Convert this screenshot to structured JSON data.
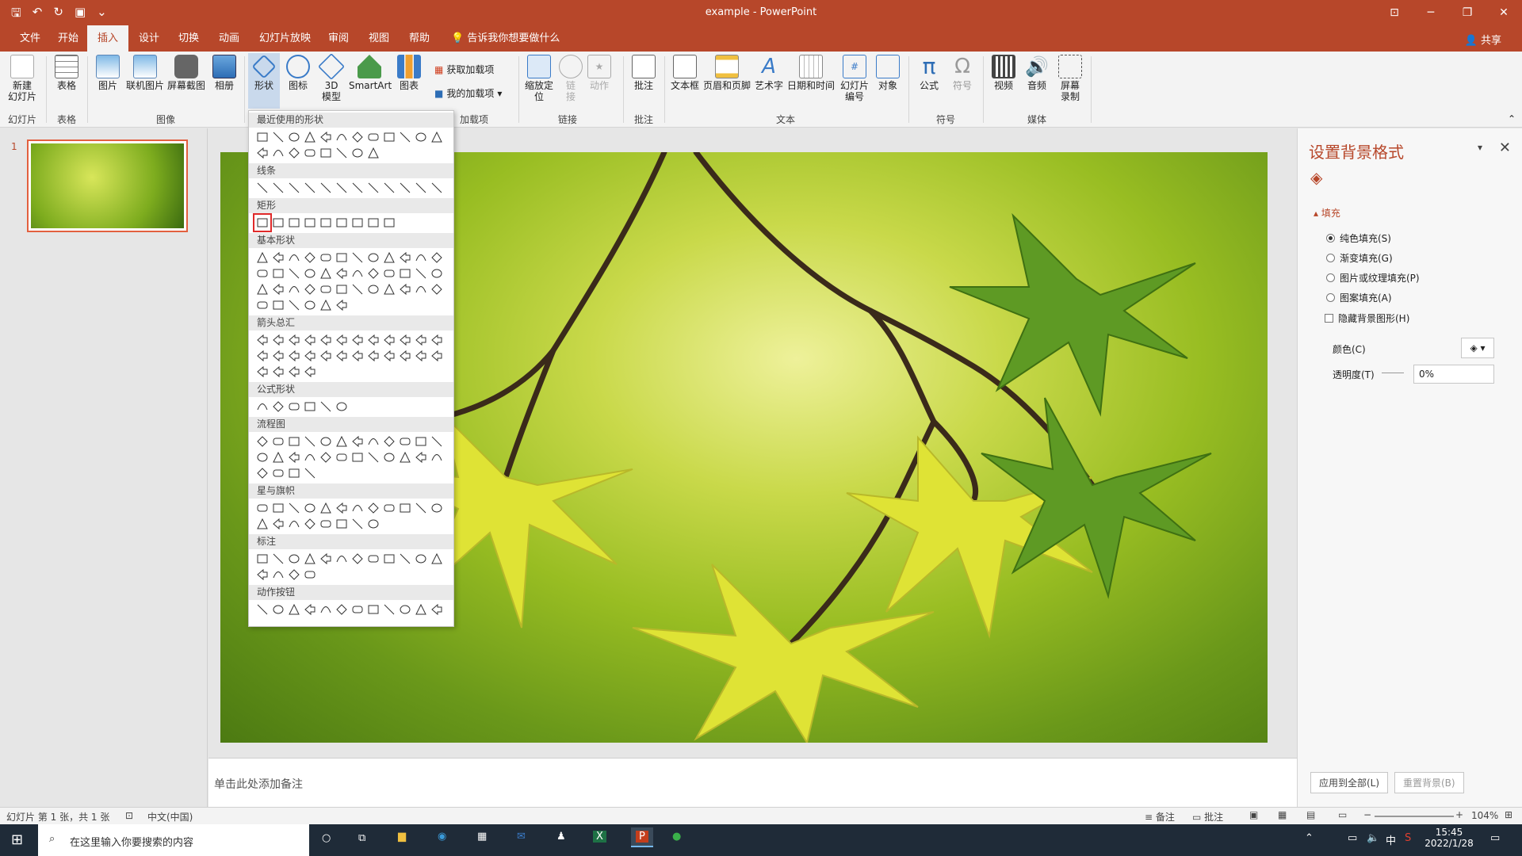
{
  "app": {
    "doc_name": "example",
    "app_name": "PowerPoint",
    "title": "example  -  PowerPoint"
  },
  "quick_access": [
    {
      "name": "save-icon",
      "glyph": "🖫"
    },
    {
      "name": "undo-icon",
      "glyph": "↶"
    },
    {
      "name": "redo-icon",
      "glyph": "↻"
    },
    {
      "name": "slideshow-icon",
      "glyph": "▣"
    },
    {
      "name": "customize-icon",
      "glyph": "⌄"
    }
  ],
  "window_controls": {
    "minimize": "─",
    "restore": "❐",
    "close": "✕",
    "ribbon_toggle": "⊡"
  },
  "menu_tabs": [
    "文件",
    "开始",
    "插入",
    "设计",
    "切换",
    "动画",
    "幻灯片放映",
    "审阅",
    "视图",
    "帮助"
  ],
  "active_tab": "插入",
  "tell_me": "告诉我你想要做什么",
  "share": "共享",
  "ribbon": {
    "new_slide": "新建\n幻灯片",
    "table": "表格",
    "picture": "图片",
    "online_picture": "联机图片",
    "screenshot": "屏幕截图",
    "album": "相册",
    "shapes": "形状",
    "icons": "图标",
    "models_3d": "3D\n模型",
    "smartart": "SmartArt",
    "chart": "图表",
    "get_addins": "获取加载项",
    "my_addins": "我的加载项",
    "zoom": "缩放定\n位",
    "link": "链\n接",
    "action": "动作",
    "comment": "批注",
    "textbox": "文本框",
    "header_footer": "页眉和页脚",
    "wordart": "艺术字",
    "datetime": "日期和时间",
    "slide_number": "幻灯片\n编号",
    "object": "对象",
    "equation": "公式",
    "symbol": "符号",
    "video": "视频",
    "audio": "音频",
    "screen_record": "屏幕\n录制",
    "groups": {
      "slides": "幻灯片",
      "tables": "表格",
      "images": "图像",
      "addins": "加载项",
      "links": "链接",
      "comments": "批注",
      "text": "文本",
      "symbols": "符号",
      "media": "媒体"
    }
  },
  "shapes_gallery": {
    "categories": [
      {
        "label": "最近使用的形状",
        "count": 20
      },
      {
        "label": "线条",
        "count": 12
      },
      {
        "label": "矩形",
        "count": 9
      },
      {
        "label": "基本形状",
        "count": 42
      },
      {
        "label": "箭头总汇",
        "count": 28
      },
      {
        "label": "公式形状",
        "count": 6
      },
      {
        "label": "流程图",
        "count": 28
      },
      {
        "label": "星与旗帜",
        "count": 20
      },
      {
        "label": "标注",
        "count": 16
      },
      {
        "label": "动作按钮",
        "count": 12
      }
    ],
    "selected": "矩形: 第一个"
  },
  "slides_panel": {
    "slide_number": "1"
  },
  "notes_placeholder": "单击此处添加备注",
  "format_pane": {
    "title": "设置背景格式",
    "section": "填充",
    "options": [
      {
        "label": "纯色填充(S)",
        "checked": true
      },
      {
        "label": "渐变填充(G)",
        "checked": false
      },
      {
        "label": "图片或纹理填充(P)",
        "checked": false
      },
      {
        "label": "图案填充(A)",
        "checked": false
      }
    ],
    "hide_bg": "隐藏背景图形(H)",
    "color_label": "颜色(C)",
    "transparency_label": "透明度(T)",
    "transparency_value": "0%",
    "apply_all": "应用到全部(L)",
    "reset_bg": "重置背景(B)"
  },
  "status": {
    "slide_info": "幻灯片 第 1 张，共 1 张",
    "language": "中文(中国)",
    "notes": "备注",
    "comments": "批注",
    "zoom": "104%"
  },
  "taskbar": {
    "search_placeholder": "在这里输入你要搜索的内容",
    "time": "15:45",
    "date": "2022/1/28",
    "ime": "中"
  },
  "colors": {
    "accent": "#b7472a",
    "selection": "#e02a2a"
  }
}
